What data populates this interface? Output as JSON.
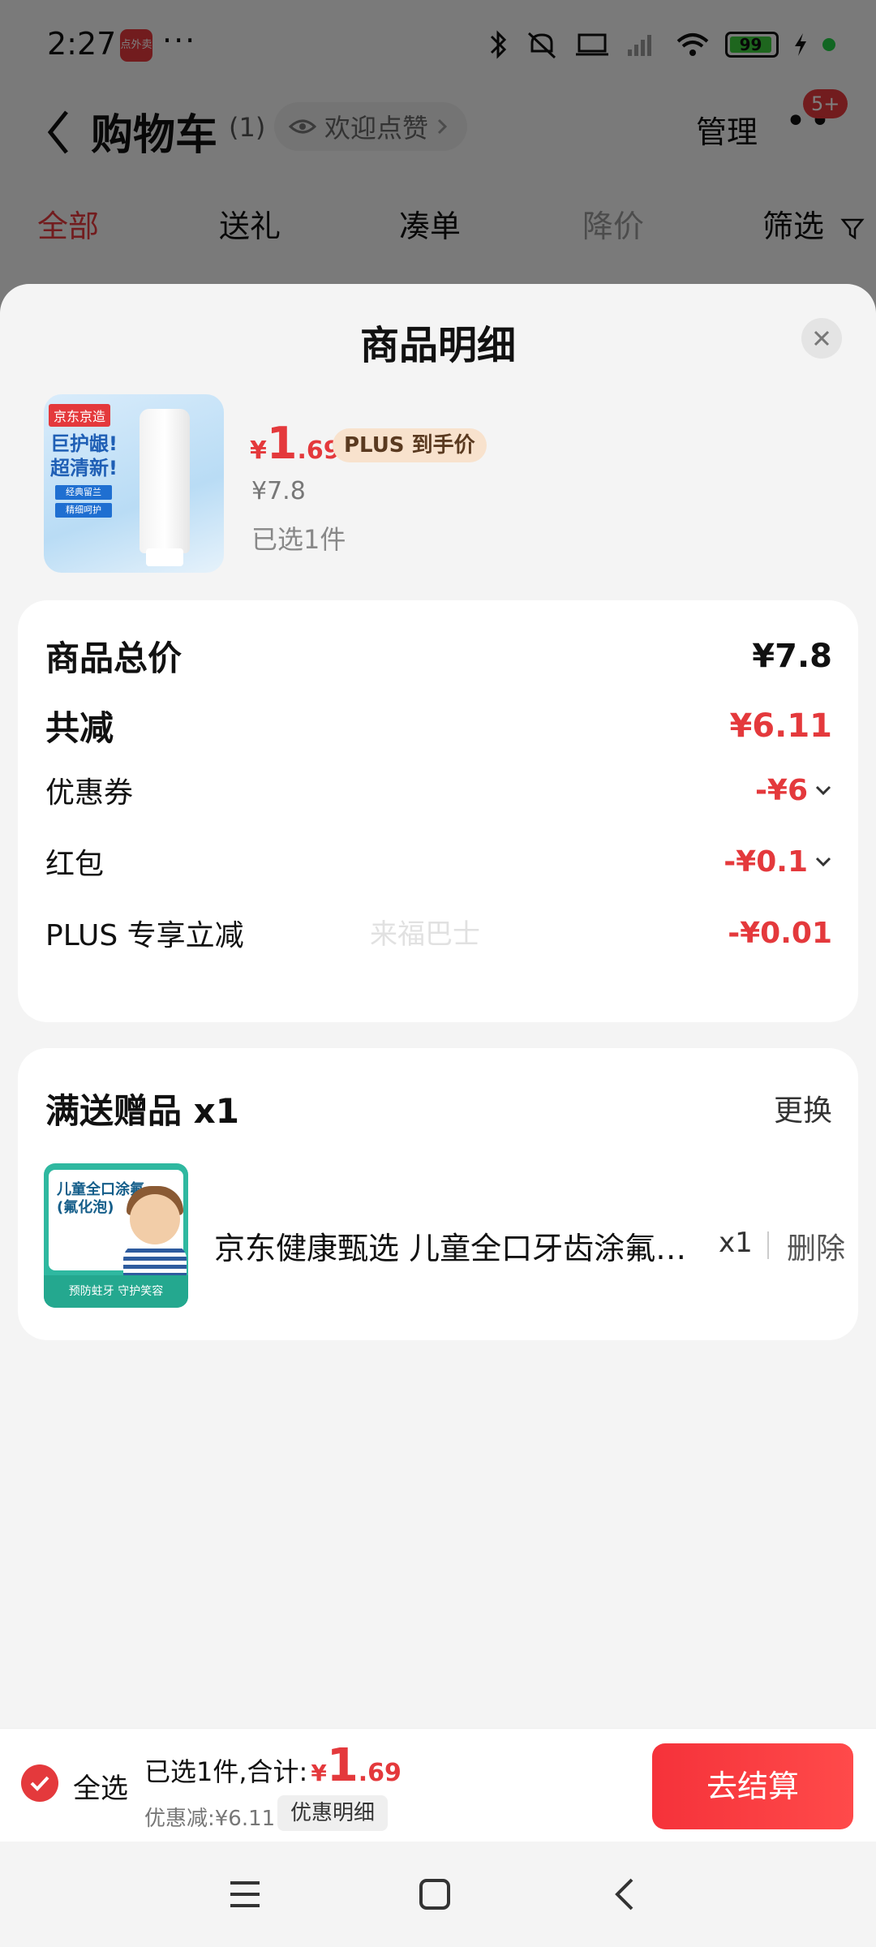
{
  "status_bar": {
    "time": "2:27",
    "app_badge": "点外卖",
    "dots": "···",
    "battery": "99"
  },
  "header": {
    "title": "购物车",
    "count": "(1)",
    "likes_label": "欢迎点赞",
    "manage": "管理",
    "more_dots": "••",
    "notification_badge": "5+"
  },
  "tabs": [
    {
      "label": "全部"
    },
    {
      "label": "送礼"
    },
    {
      "label": "凑单"
    },
    {
      "label": "降价"
    },
    {
      "label": "筛选"
    }
  ],
  "sheet": {
    "title": "商品明细",
    "product": {
      "image_tag": "京东京造",
      "image_text": "巨护龈!\n超清新!",
      "image_chip1": "经典留兰",
      "image_chip2": "精细呵护",
      "price_symbol": "¥",
      "price_int": "1",
      "price_dec": ".69",
      "plus_label": "PLUS 到手价",
      "original_price": "¥7.8",
      "selected": "已选1件"
    },
    "price_details": {
      "total_label": "商品总价",
      "total_value": "¥7.8",
      "reduce_label": "共减",
      "reduce_value": "¥6.11",
      "coupon_label": "优惠券",
      "coupon_value": "-¥6",
      "redpacket_label": "红包",
      "redpacket_value": "-¥0.1",
      "plus_label": "PLUS 专享立减",
      "plus_value": "-¥0.01",
      "watermark": "来福巴士"
    },
    "gift": {
      "title": "满送赠品 x1",
      "change": "更换",
      "image_title": "儿童全口涂氟\n(氟化泡)",
      "image_bottom": "预防蛀牙 守护笑容",
      "name": "京东健康甄选 儿童全口牙齿涂氟泡沫",
      "qty": "x1",
      "delete": "删除"
    }
  },
  "checkout": {
    "select_all": "全选",
    "total_label": "已选1件,合计:",
    "total_symbol": "¥",
    "total_int": "1",
    "total_dec": ".69",
    "discount": "优惠减:¥6.11",
    "detail": "优惠明细",
    "button": "去结算"
  },
  "colors": {
    "accent": "#e4393c",
    "plus_gold": "#f8e2cd"
  }
}
